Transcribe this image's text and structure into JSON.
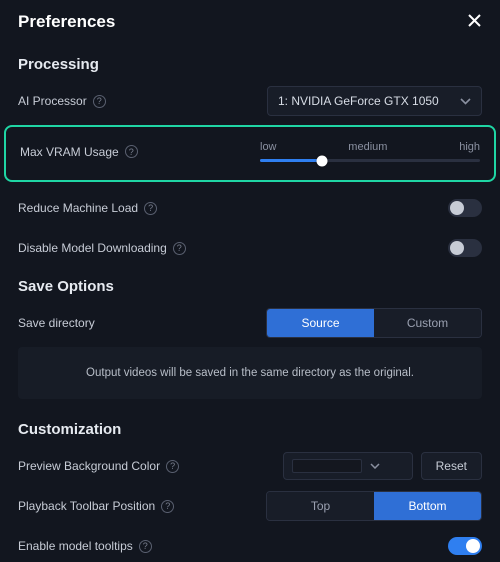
{
  "header": {
    "title": "Preferences"
  },
  "processing": {
    "title": "Processing",
    "ai_processor_label": "AI Processor",
    "ai_processor_value": "1: NVIDIA GeForce GTX 1050",
    "max_vram_label": "Max VRAM Usage",
    "slider_low": "low",
    "slider_medium": "medium",
    "slider_high": "high",
    "reduce_load_label": "Reduce Machine Load",
    "disable_download_label": "Disable Model Downloading"
  },
  "save": {
    "title": "Save Options",
    "directory_label": "Save directory",
    "source_label": "Source",
    "custom_label": "Custom",
    "info_text": "Output videos will be saved in the same directory as the original."
  },
  "custom": {
    "title": "Customization",
    "bgcolor_label": "Preview Background Color",
    "reset_label": "Reset",
    "playback_label": "Playback Toolbar Position",
    "top_label": "Top",
    "bottom_label": "Bottom",
    "tooltips_label": "Enable model tooltips"
  }
}
